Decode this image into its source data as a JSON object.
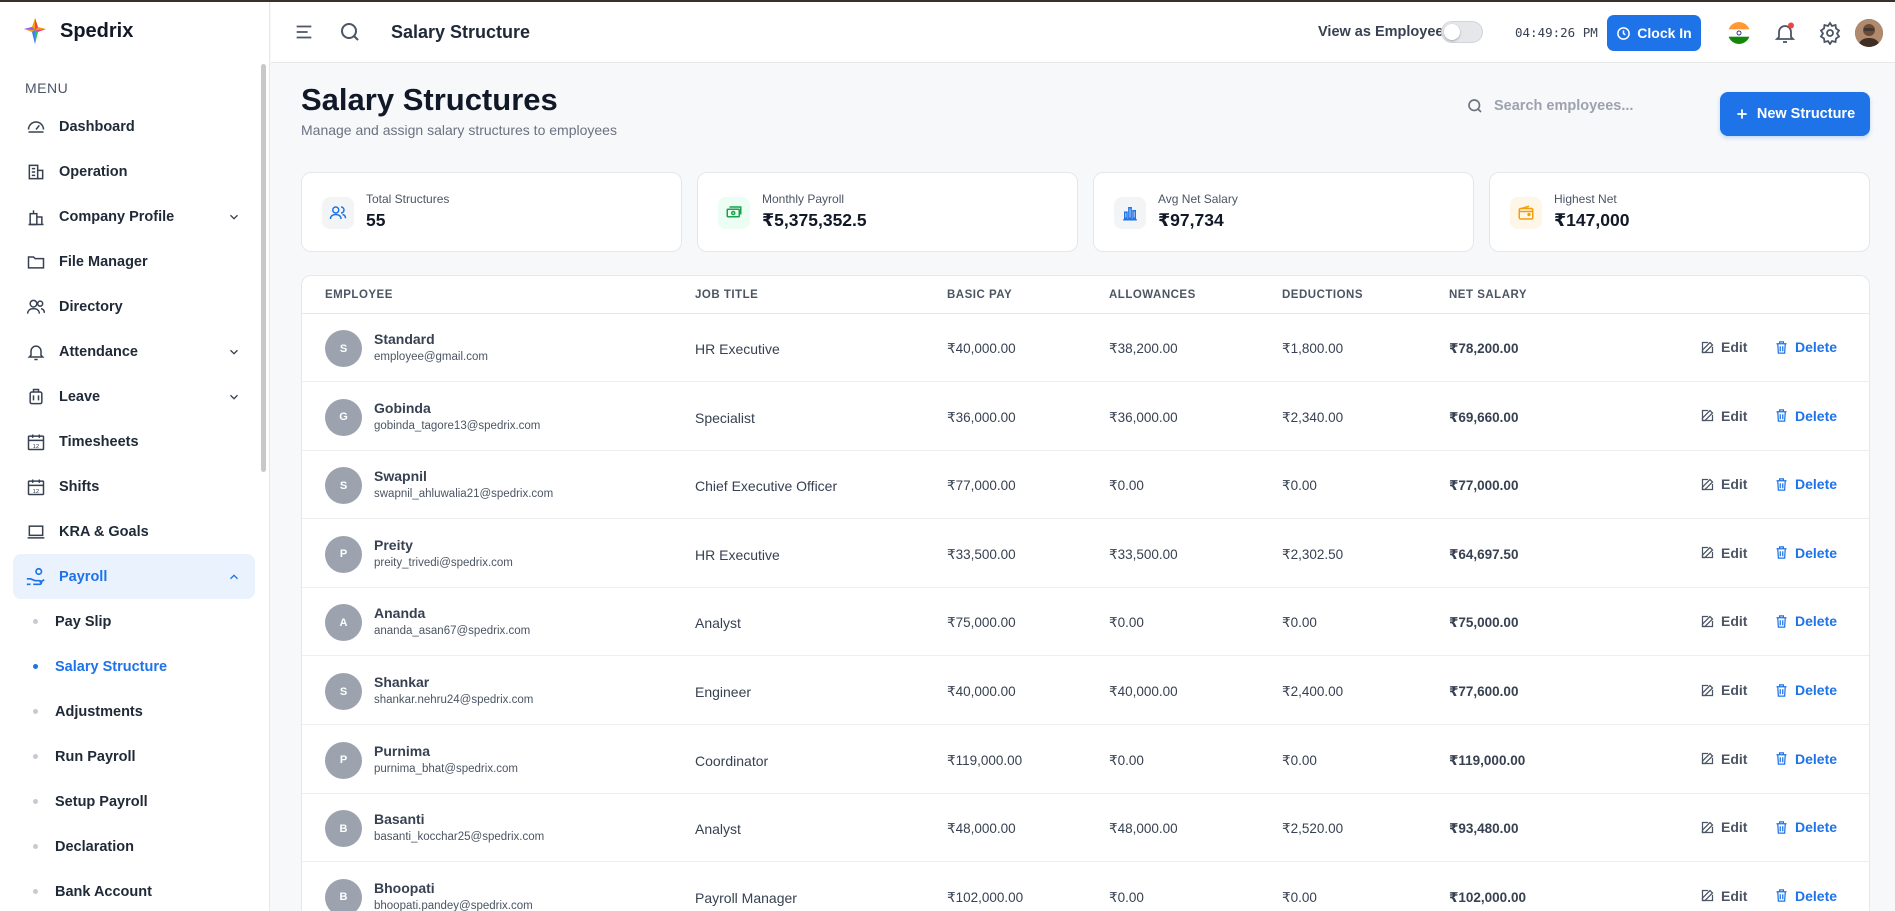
{
  "brand": {
    "name": "Spedrix"
  },
  "sidebar": {
    "menu_title": "MENU",
    "items": [
      {
        "label": "Dashboard",
        "icon": "gauge-icon"
      },
      {
        "label": "Operation",
        "icon": "building-icon"
      },
      {
        "label": "Company Profile",
        "icon": "company-icon",
        "expandable": true
      },
      {
        "label": "File Manager",
        "icon": "folder-icon"
      },
      {
        "label": "Directory",
        "icon": "users-icon"
      },
      {
        "label": "Attendance",
        "icon": "bell-icon",
        "expandable": true
      },
      {
        "label": "Leave",
        "icon": "luggage-icon",
        "expandable": true
      },
      {
        "label": "Timesheets",
        "icon": "calendar-icon"
      },
      {
        "label": "Shifts",
        "icon": "calendar-icon"
      },
      {
        "label": "KRA & Goals",
        "icon": "laptop-icon"
      },
      {
        "label": "Payroll",
        "icon": "hand-coins-icon",
        "expandable": true,
        "active": true
      }
    ],
    "payroll_sub": [
      {
        "label": "Pay Slip"
      },
      {
        "label": "Salary Structure",
        "active": true
      },
      {
        "label": "Adjustments"
      },
      {
        "label": "Run Payroll"
      },
      {
        "label": "Setup Payroll"
      },
      {
        "label": "Declaration"
      },
      {
        "label": "Bank Account"
      }
    ]
  },
  "header": {
    "title": "Salary Structure",
    "view_as_label": "View as Employee",
    "clock": "04:49:26 PM",
    "clock_in_label": "Clock In"
  },
  "page": {
    "title": "Salary Structures",
    "subtitle": "Manage and assign salary structures to employees",
    "search_placeholder": "Search employees...",
    "new_button_label": "New Structure"
  },
  "stats": [
    {
      "label": "Total Structures",
      "value": "55",
      "icon": "users-icon",
      "color": "#1e73e8"
    },
    {
      "label": "Monthly Payroll",
      "value": "₹5,375,352.5",
      "icon": "money-icon",
      "color": "#16a34a"
    },
    {
      "label": "Avg Net Salary",
      "value": "₹97,734",
      "icon": "bar-chart-icon",
      "color": "#1e73e8"
    },
    {
      "label": "Highest Net",
      "value": "₹147,000",
      "icon": "wallet-icon",
      "color": "#f59e0b"
    }
  ],
  "table": {
    "headers": [
      "EMPLOYEE",
      "JOB TITLE",
      "BASIC PAY",
      "ALLOWANCES",
      "DEDUCTIONS",
      "NET SALARY"
    ],
    "edit_label": "Edit",
    "delete_label": "Delete",
    "rows": [
      {
        "initial": "S",
        "name": "Standard",
        "email": "employee@gmail.com",
        "job": "HR Executive",
        "basic": "₹40,000.00",
        "allowances": "₹38,200.00",
        "deductions": "₹1,800.00",
        "net": "₹78,200.00"
      },
      {
        "initial": "G",
        "name": "Gobinda",
        "email": "gobinda_tagore13@spedrix.com",
        "job": "Specialist",
        "basic": "₹36,000.00",
        "allowances": "₹36,000.00",
        "deductions": "₹2,340.00",
        "net": "₹69,660.00"
      },
      {
        "initial": "S",
        "name": "Swapnil",
        "email": "swapnil_ahluwalia21@spedrix.com",
        "job": "Chief Executive Officer",
        "basic": "₹77,000.00",
        "allowances": "₹0.00",
        "deductions": "₹0.00",
        "net": "₹77,000.00"
      },
      {
        "initial": "P",
        "name": "Preity",
        "email": "preity_trivedi@spedrix.com",
        "job": "HR Executive",
        "basic": "₹33,500.00",
        "allowances": "₹33,500.00",
        "deductions": "₹2,302.50",
        "net": "₹64,697.50"
      },
      {
        "initial": "A",
        "name": "Ananda",
        "email": "ananda_asan67@spedrix.com",
        "job": "Analyst",
        "basic": "₹75,000.00",
        "allowances": "₹0.00",
        "deductions": "₹0.00",
        "net": "₹75,000.00"
      },
      {
        "initial": "S",
        "name": "Shankar",
        "email": "shankar.nehru24@spedrix.com",
        "job": "Engineer",
        "basic": "₹40,000.00",
        "allowances": "₹40,000.00",
        "deductions": "₹2,400.00",
        "net": "₹77,600.00"
      },
      {
        "initial": "P",
        "name": "Purnima",
        "email": "purnima_bhat@spedrix.com",
        "job": "Coordinator",
        "basic": "₹119,000.00",
        "allowances": "₹0.00",
        "deductions": "₹0.00",
        "net": "₹119,000.00"
      },
      {
        "initial": "B",
        "name": "Basanti",
        "email": "basanti_kocchar25@spedrix.com",
        "job": "Analyst",
        "basic": "₹48,000.00",
        "allowances": "₹48,000.00",
        "deductions": "₹2,520.00",
        "net": "₹93,480.00"
      },
      {
        "initial": "B",
        "name": "Bhoopati",
        "email": "bhoopati.pandey@spedrix.com",
        "job": "Payroll Manager",
        "basic": "₹102,000.00",
        "allowances": "₹0.00",
        "deductions": "₹0.00",
        "net": "₹102,000.00"
      }
    ]
  },
  "colors": {
    "accent": "#1e73e8",
    "accent_bg": "#eaf2fd"
  }
}
